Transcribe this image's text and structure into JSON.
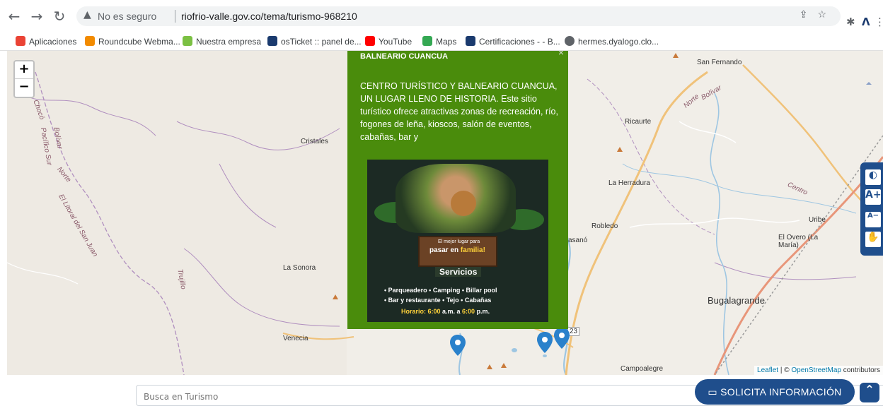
{
  "browser": {
    "back_icon": "back-arrow-icon",
    "forward_icon": "forward-arrow-icon",
    "reload_icon": "reload-icon",
    "security_label": "No es seguro",
    "url": "riofrio-valle.gov.co/tema/turismo-968210"
  },
  "bookmarks": [
    {
      "label": "Aplicaciones",
      "icon": "apps-grid-icon",
      "color": "#ea4335"
    },
    {
      "label": "Roundcube Webma...",
      "icon": "roundcube-icon",
      "color": "#f28b00"
    },
    {
      "label": "Nuestra empresa",
      "icon": "empresa-icon",
      "color": "#7bc043"
    },
    {
      "label": "osTicket :: panel de...",
      "icon": "osticket-icon",
      "color": "#1a3a6e"
    },
    {
      "label": "YouTube",
      "icon": "youtube-icon",
      "color": "#ff0000"
    },
    {
      "label": "Maps",
      "icon": "maps-icon",
      "color": "#34a853"
    },
    {
      "label": "Certificaciones - - B...",
      "icon": "certificaciones-icon",
      "color": "#1a3a6e"
    },
    {
      "label": "hermes.dyalogo.clo...",
      "icon": "globe-icon",
      "color": "#5f6368"
    }
  ],
  "map": {
    "zoom_in": "+",
    "zoom_out": "−",
    "places": [
      "San Fernando",
      "Ricaurte",
      "Cristales",
      "La Herradura",
      "Robledo",
      "asanó",
      "Uribe",
      "El Overo (La María)",
      "La Sonora",
      "Bugalagrande",
      "Venecia",
      "Campoalegre",
      "23"
    ],
    "road_labels": [
      "Chocó",
      "Pacífico Sur",
      "Bolívar",
      "Norte",
      "El Litoral del San Juan",
      "Trujillo",
      "Norte",
      "Bolívar",
      "Centro"
    ],
    "attribution_leaflet": "Leaflet",
    "attribution_sep": " | © ",
    "attribution_osm": "OpenStreetMap",
    "attribution_rest": " contributors"
  },
  "popup": {
    "title": "BALNEARIO CUANCUA",
    "close": "×",
    "description": "CENTRO TURÍSTICO Y BALNEARIO CUANCUA, UN LUGAR LLENO DE HISTORIA. Este sitio turístico ofrece atractivas zonas de recreación, río, fogones de leña, kioscos, salón de eventos, cabañas, bar y",
    "flyer": {
      "tagline_small": "El mejor lugar para",
      "tagline_a": "pasar en ",
      "tagline_b": "familia!",
      "services_title": "Servicios",
      "services_line1": "• Parqueadero • Camping • Billar pool",
      "services_line2": "• Bar y restaurante • Tejo • Cabañas",
      "hours_label": "Horario: 6:00",
      "hours_mid": " a.m. a ",
      "hours_end": "6:00",
      "hours_tail": " p.m."
    }
  },
  "accessibility": {
    "contrast_icon": "contrast-icon",
    "increase_text": "A+",
    "decrease_text": "A−",
    "sign_language_icon": "sign-language-icon"
  },
  "footer": {
    "search_placeholder": "Busca en Turismo",
    "cta_label": "SOLICITA INFORMACIÓN",
    "up_icon": "chevron-up-icon"
  }
}
